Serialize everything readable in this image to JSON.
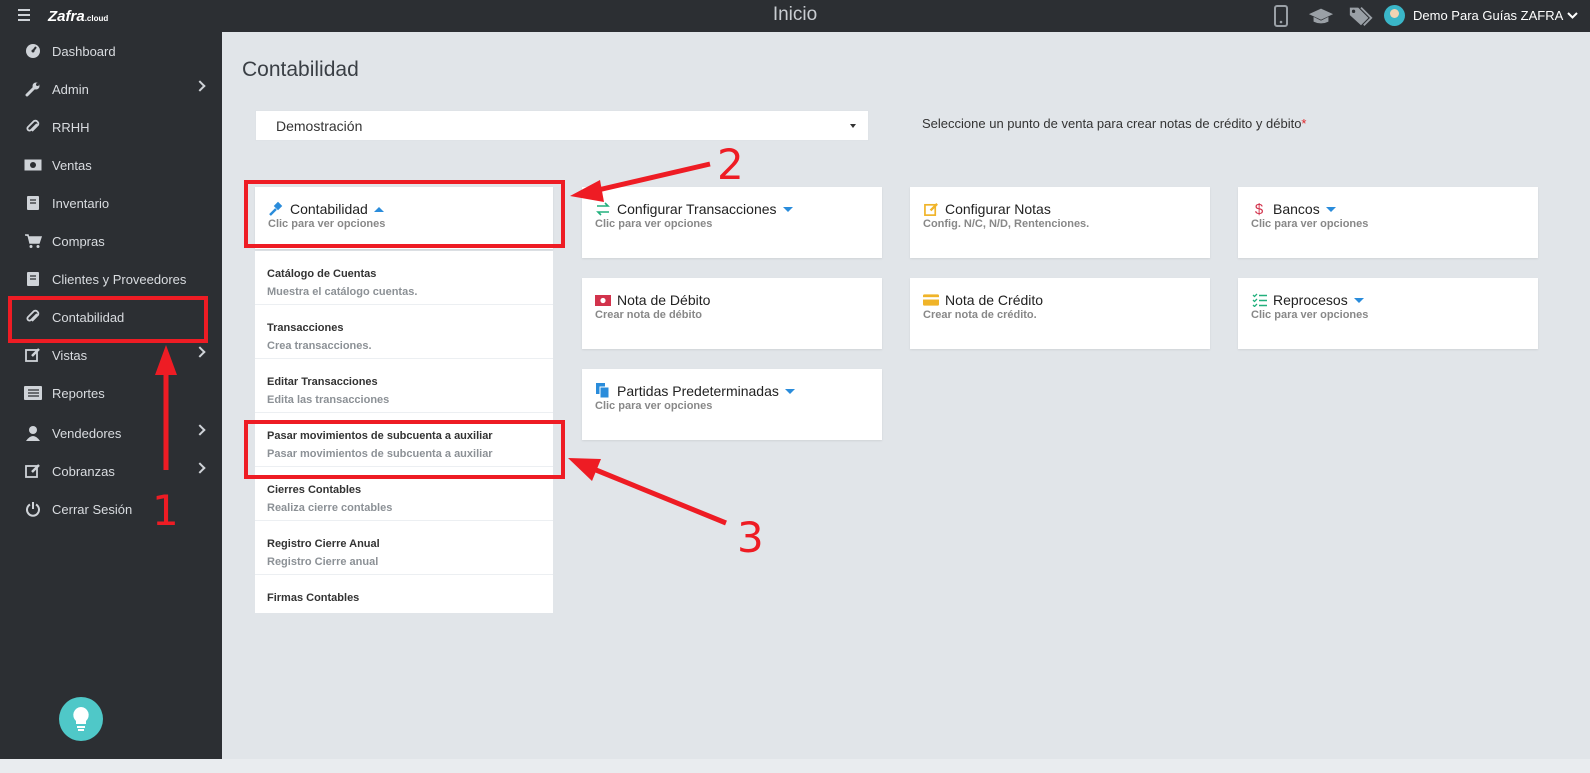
{
  "app": {
    "brand": "Zafra",
    "brand_suffix": ".cloud",
    "page_title": "Inicio",
    "user_name": "Demo Para Guías ZAFRA",
    "top_icons": [
      "mobile-icon",
      "graduation-cap-icon",
      "tags-icon"
    ]
  },
  "sidebar": {
    "items": [
      {
        "label": "Dashboard",
        "icon": "dashboard-icon"
      },
      {
        "label": "Admin",
        "icon": "wrench-icon"
      },
      {
        "label": "RRHH",
        "icon": "paperclip-icon"
      },
      {
        "label": "Ventas",
        "icon": "money-icon"
      },
      {
        "label": "Inventario",
        "icon": "book-icon"
      },
      {
        "label": "Compras",
        "icon": "cart-icon"
      },
      {
        "label": "Clientes y Proveedores",
        "icon": "book-icon"
      },
      {
        "label": "Contabilidad",
        "icon": "paperclip-icon"
      },
      {
        "label": "Vistas",
        "icon": "edit-icon"
      },
      {
        "label": "Reportes",
        "icon": "list-icon"
      },
      {
        "label": "Vendedores",
        "icon": "user-icon"
      },
      {
        "label": "Cobranzas",
        "icon": "edit-icon"
      },
      {
        "label": "Cerrar Sesión",
        "icon": "power-icon"
      }
    ]
  },
  "main": {
    "title": "Contabilidad",
    "select_value": "Demostración",
    "hint": "Seleccione un punto de venta para crear notas de crédito y débito",
    "hint_required": "*",
    "cards": {
      "contabilidad": {
        "title": "Contabilidad",
        "sub": "Clic para ver opciones"
      },
      "config_trans": {
        "title": "Configurar Transacciones",
        "sub": "Clic para ver opciones"
      },
      "config_notas": {
        "title": "Configurar Notas",
        "sub": "Config. N/C, N/D, Rentenciones."
      },
      "bancos": {
        "title": "Bancos",
        "sub": "Clic para ver opciones"
      },
      "nota_debito": {
        "title": "Nota de Débito",
        "sub": "Crear nota de débito"
      },
      "nota_credito": {
        "title": "Nota de Crédito",
        "sub": "Crear nota de crédito."
      },
      "reprocesos": {
        "title": "Reprocesos",
        "sub": "Clic para ver opciones"
      },
      "partidas": {
        "title": "Partidas Predeterminadas",
        "sub": "Clic para ver opciones"
      }
    },
    "dropdown": [
      {
        "title": "Catálogo de Cuentas",
        "sub": "Muestra el catálogo cuentas."
      },
      {
        "title": "Transacciones",
        "sub": "Crea transacciones."
      },
      {
        "title": "Editar Transacciones",
        "sub": "Edita las transacciones"
      },
      {
        "title": "Pasar movimientos de subcuenta a auxiliar",
        "sub": "Pasar movimientos de subcuenta a auxiliar"
      },
      {
        "title": "Cierres Contables",
        "sub": "Realiza cierre contables"
      },
      {
        "title": "Registro Cierre Anual",
        "sub": "Registro Cierre anual"
      },
      {
        "title": "Firmas Contables",
        "sub": ""
      }
    ]
  },
  "annotations": {
    "step1": "1",
    "step2": "2",
    "step3": "3",
    "color": "#ee1c24"
  },
  "colors": {
    "sidebar_bg": "#2c2f33",
    "content_bg": "#e1e5e9",
    "accent_blue": "#2a8cdb"
  }
}
